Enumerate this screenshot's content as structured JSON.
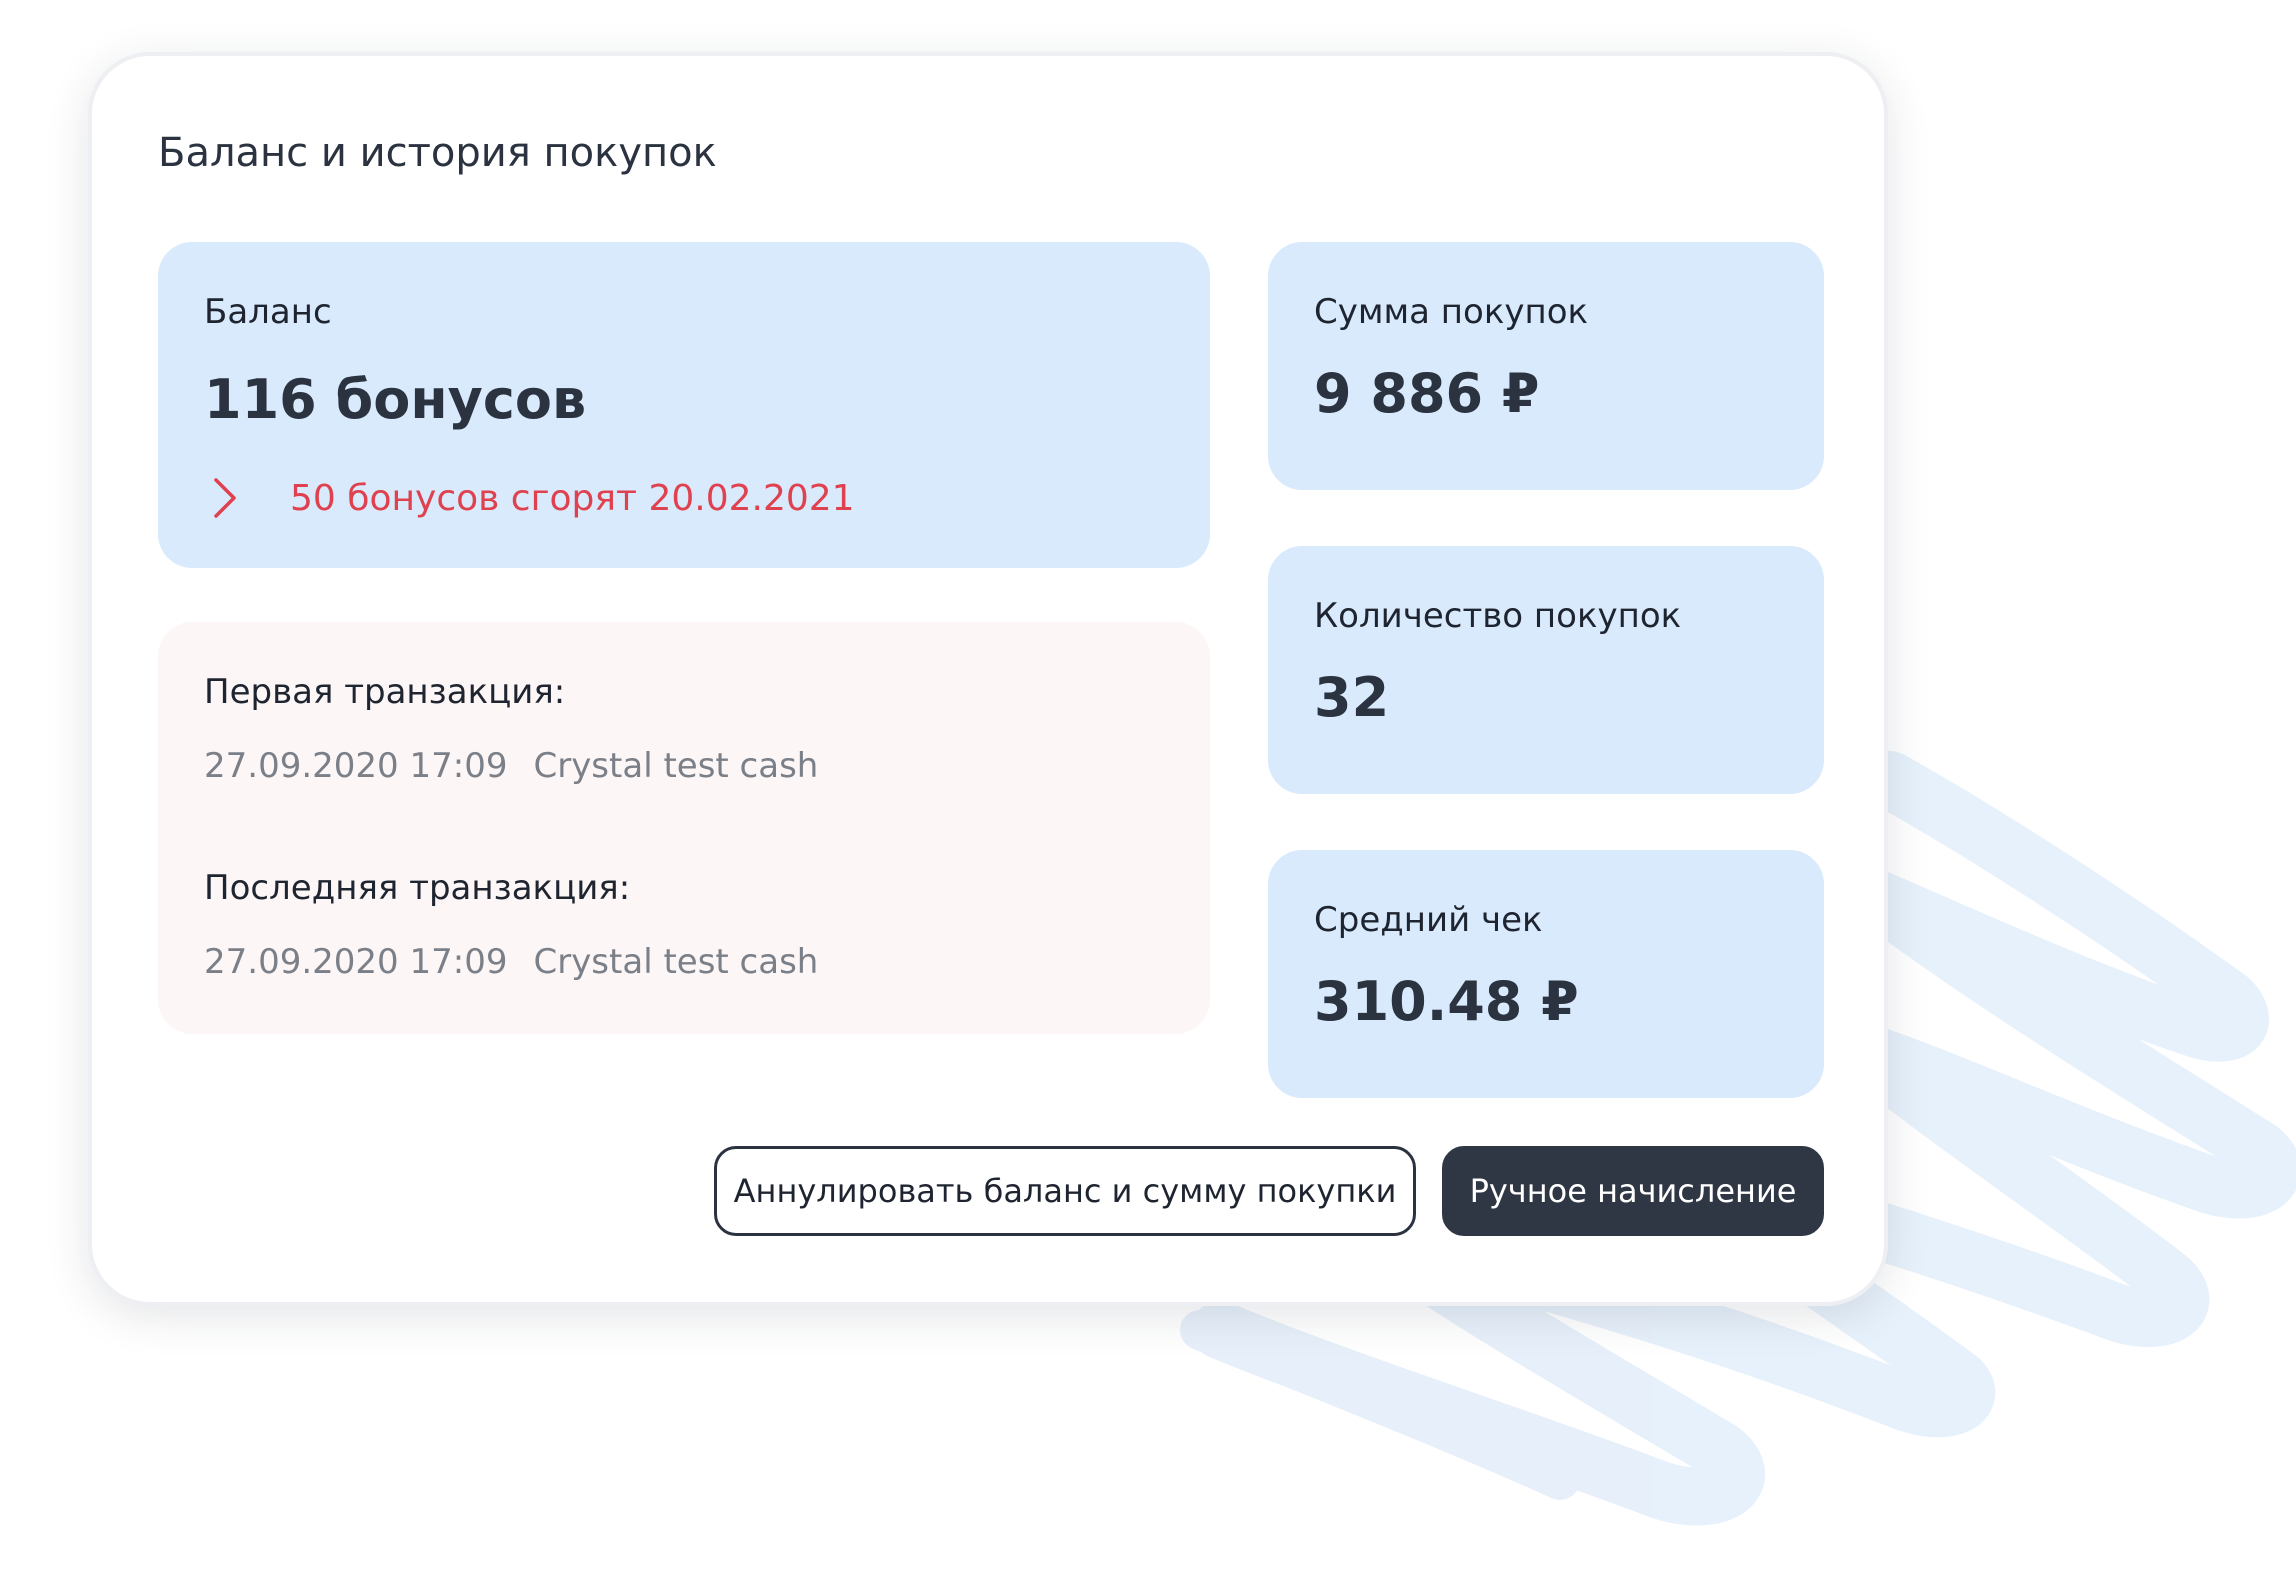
{
  "card": {
    "title": "Баланс и история покупок"
  },
  "balance": {
    "label": "Баланс",
    "value": "116 бонусов",
    "expire_icon": "chevron-right-icon",
    "expire_text": "50 бонусов сгорят 20.02.2021"
  },
  "transactions": {
    "first": {
      "label": "Первая транзакция:",
      "datetime": "27.09.2020 17:09",
      "place": "Crystal test cash"
    },
    "last": {
      "label": "Последняя транзакция:",
      "datetime": "27.09.2020 17:09",
      "place": "Crystal test cash"
    }
  },
  "metrics": [
    {
      "label": "Сумма покупок",
      "value": "9 886 ₽"
    },
    {
      "label": "Количество покупок",
      "value": "32"
    },
    {
      "label": "Средний чек",
      "value": "310.48 ₽"
    }
  ],
  "actions": {
    "reset_label": "Аннулировать баланс и сумму покупки",
    "manual_label": "Ручное начисление"
  },
  "colors": {
    "tile_blue": "#d8eafc",
    "tile_pink": "#fcf6f6",
    "warning_red": "#e0414f",
    "primary_dark": "#2f3644",
    "brush_blue": "#e3eefa"
  }
}
